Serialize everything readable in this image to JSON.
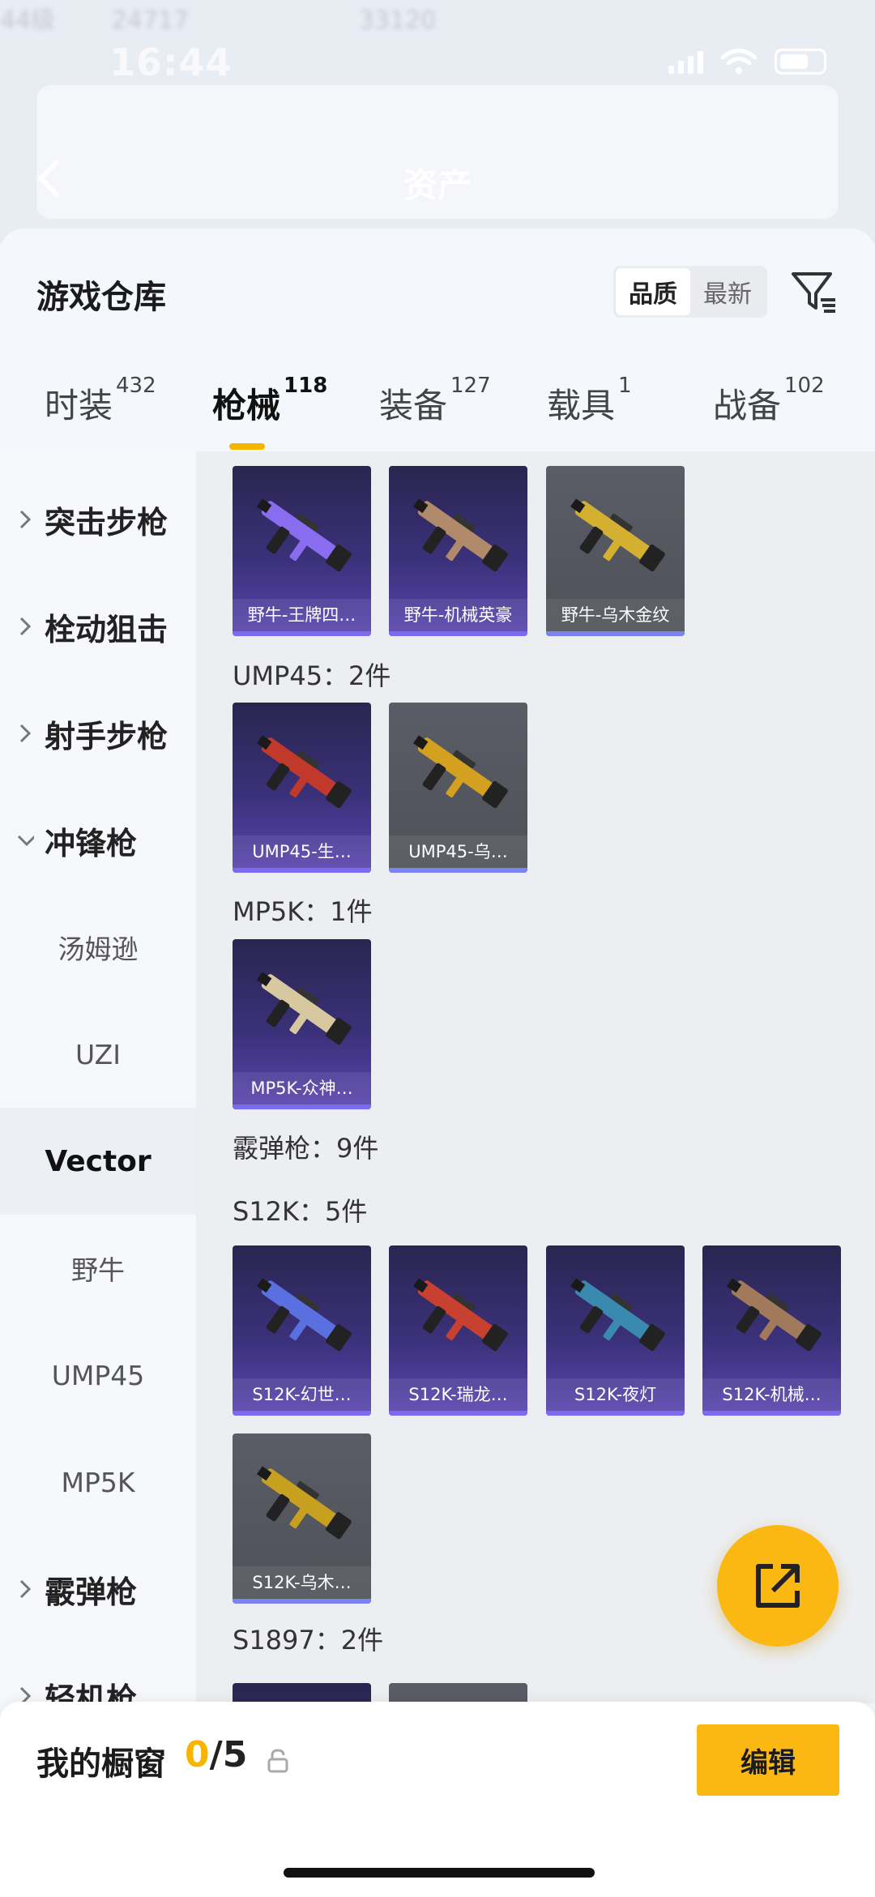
{
  "status_bar": {
    "time": "16:44"
  },
  "background": {
    "title": "资产",
    "stats": [
      "44级",
      "24717",
      "33120"
    ]
  },
  "sheet": {
    "title": "游戏仓库",
    "sort": {
      "quality_label": "品质",
      "latest_label": "最新",
      "selected": "品质"
    },
    "filter_icon": "filter-icon"
  },
  "tabs": [
    {
      "label": "时装",
      "count": "432"
    },
    {
      "label": "枪械",
      "count": "118",
      "active": true
    },
    {
      "label": "装备",
      "count": "127"
    },
    {
      "label": "载具",
      "count": "1"
    },
    {
      "label": "战备",
      "count": "102"
    }
  ],
  "sidebar": {
    "items": [
      {
        "label": "突击步枪",
        "type": "category",
        "expanded": false
      },
      {
        "label": "栓动狙击",
        "type": "category",
        "expanded": false
      },
      {
        "label": "射手步枪",
        "type": "category",
        "expanded": false
      },
      {
        "label": "冲锋枪",
        "type": "category",
        "expanded": true
      },
      {
        "label": "汤姆逊",
        "type": "sub"
      },
      {
        "label": "UZI",
        "type": "sub"
      },
      {
        "label": "Vector",
        "type": "sub",
        "selected": true
      },
      {
        "label": "野牛",
        "type": "sub"
      },
      {
        "label": "UMP45",
        "type": "sub"
      },
      {
        "label": "MP5K",
        "type": "sub"
      },
      {
        "label": "霰弹枪",
        "type": "category",
        "expanded": false
      },
      {
        "label": "轻机枪",
        "type": "category",
        "expanded": false
      }
    ]
  },
  "groups": {
    "bizon": {
      "items": [
        {
          "name": "野牛-王牌四…",
          "tier": "purple",
          "color": "#8a6cf0"
        },
        {
          "name": "野牛-机械英豪",
          "tier": "purple",
          "color": "#b08a6a"
        },
        {
          "name": "野牛-乌木金纹",
          "tier": "gray",
          "color": "#d4b030"
        }
      ]
    },
    "ump45": {
      "label": "UMP45：2件",
      "items": [
        {
          "name": "UMP45-生…",
          "tier": "purple",
          "color": "#c0392b"
        },
        {
          "name": "UMP45-乌…",
          "tier": "gray",
          "color": "#d4a020"
        }
      ]
    },
    "mp5k": {
      "label": "MP5K：1件",
      "items": [
        {
          "name": "MP5K-众神…",
          "tier": "purple",
          "color": "#d8c8a0"
        }
      ]
    },
    "shotgun": {
      "label": "霰弹枪：9件"
    },
    "s12k": {
      "label": "S12K：5件",
      "items": [
        {
          "name": "S12K-幻世…",
          "tier": "purple",
          "color": "#5a70e0"
        },
        {
          "name": "S12K-瑞龙…",
          "tier": "purple",
          "color": "#c84030"
        },
        {
          "name": "S12K-夜灯",
          "tier": "purple",
          "color": "#3a8ab0"
        },
        {
          "name": "S12K-机械…",
          "tier": "purple",
          "color": "#a07a5a"
        },
        {
          "name": "S12K-乌木…",
          "tier": "gray",
          "color": "#c8a020"
        }
      ]
    },
    "s1897": {
      "label": "S1897：2件"
    }
  },
  "bottom_bar": {
    "label": "我的橱窗",
    "current": "0",
    "total": "/5",
    "edit_label": "编辑"
  },
  "colors": {
    "accent": "#fbb812",
    "purple_tier": "#3b317a",
    "gray_tier": "#55575f"
  }
}
